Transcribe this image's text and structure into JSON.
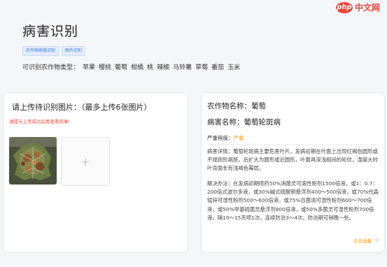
{
  "header": {
    "title": "病害识别",
    "tags": [
      "农作物病害识别",
      "图片识别"
    ],
    "crops_label": "可识别农作物类型：",
    "crops": [
      "苹果",
      "樱桃",
      "葡萄",
      "柑橘",
      "桃",
      "辣椒",
      "马铃薯",
      "草莓",
      "番茄",
      "玉米"
    ]
  },
  "watermark": {
    "logo": "php",
    "text": "中文网"
  },
  "upload": {
    "title": "请上传待识别图片：（最多上传6张图片）",
    "hint": "请提示上传成功后再查看结果!",
    "add_symbol": "+"
  },
  "result": {
    "crop_label": "农作物名称：",
    "crop_value": "葡萄",
    "disease_label": "病害名称：",
    "disease_value": "葡萄轮斑病",
    "severity_label": "严重程度：",
    "severity_value": "严重",
    "detail": "病害详情：葡萄轮斑病主要危害叶片。发病初期在叶面上出现红褐色圆形或不规则形病斑，后扩大为圆形或近圆形，叶面具深浅相间的轮纹，湿度大时叶背面长有浅褐色霉层。",
    "method": "解决办法：在发病初期喷药50%消菌灵可溶性粉剂1500倍液，或1：0.7：200倍式波尔多液，或30%碱式硫酸铜悬浮剂400～500倍液，或70%代森锰锌可湿性粉剂500～600倍液，或75%百菌清可湿性粉剂600～700倍液，或50%甲基硫菌灵悬浮剂800倍液，或50%多菌灵可湿性粉剂700倍液。隔10～15天喷1次，连续防治3～4次。防治期可稍晚一些。",
    "favorite_label": "点击收藏",
    "favorite_icon": "star-icon"
  },
  "colors": {
    "accent": "#3a7bd5",
    "warning": "#f39c12",
    "danger": "#e74c3c"
  }
}
